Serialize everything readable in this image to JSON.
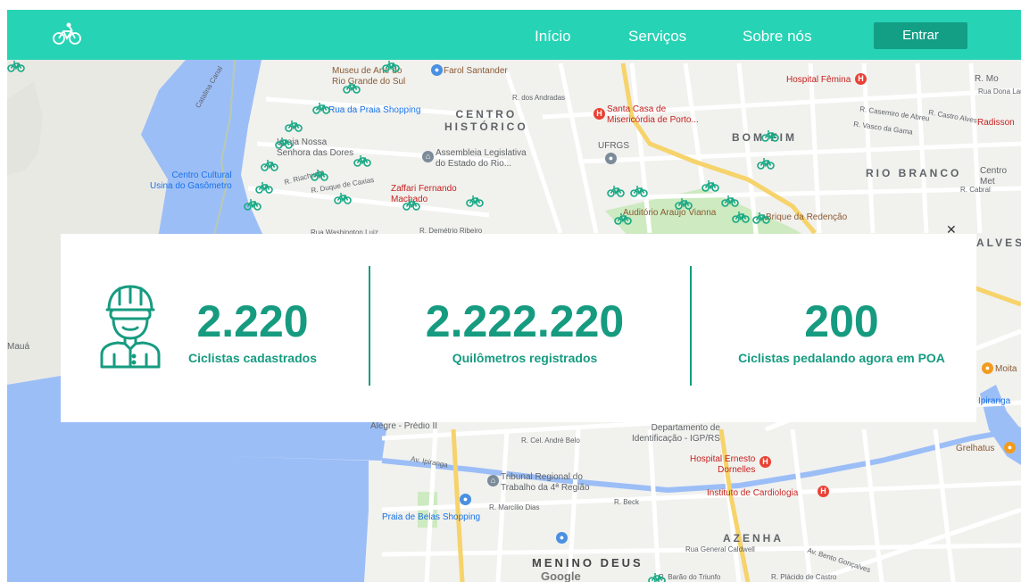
{
  "nav": {
    "links": [
      "Início",
      "Serviços",
      "Sobre nós"
    ],
    "login_label": "Entrar"
  },
  "stats": [
    {
      "value": "2.220",
      "label": "Ciclistas cadastrados"
    },
    {
      "value": "2.222.220",
      "label": "Quilômetros registrados"
    },
    {
      "value": "200",
      "label": "Ciclistas pedalando agora em POA"
    }
  ],
  "map": {
    "labels": {
      "museu": "Museu de Arte do\nRio Grande do Sul",
      "farol": "Farol Santander",
      "praia_shopping": "Rua da Praia Shopping",
      "centro_historico": "CENTRO\nHISTÓRICO",
      "santa_casa": "Santa Casa de\nMisericórdia de Porto...",
      "hospital_femina": "Hospital Fêmina",
      "bom_fim": "BOM FIM",
      "rio_branco": "RIO BRANCO",
      "igreja": "Igreja Nossa\nSenhora das Dores",
      "assembleia": "Assembleia Legislativa\ndo Estado do Rio...",
      "ufrgs": "UFRGS",
      "centro_cultural": "Centro Cultural\nUsina do Gasômetro",
      "zaffari": "Zaffari Fernando\nMachado",
      "auditorio": "Auditório Araújo Vianna",
      "brique": "Brique da Redenção",
      "radisson": "Radisson",
      "maua": "Mauá",
      "alves": "ALVES",
      "alegre": "Alegre - Prédio II",
      "departamento": "Departamento de\nIdentificação - IGP/RS",
      "hospital_ernesto": "Hospital Ernesto\nDornelles",
      "instituto": "Instituto de Cardiologia",
      "tribunal": "Tribunal Regional do\nTrabalho da 4ª Região",
      "praia_belas": "Praia de Belas Shopping",
      "azenha": "AZENHA",
      "menino_deus": "MENINO DEUS",
      "grelhatus": "Grelhatus",
      "moita": "Moita",
      "ipiranga_right": "Ipiranga",
      "google": "Google",
      "centro_met": "Centro\nMet",
      "r_mo": "R. Mo",
      "av_ipiranga": "Av. Ipiranga",
      "av_bento": "Av. Bento Gonçalves",
      "r_barao": "R. Barão do Triunfo",
      "r_placido": "R. Plácido de Castro",
      "r_marcilio": "R. Marcílio Dias",
      "r_beck": "R. Beck",
      "rua_general": "Rua General Caldwell",
      "r_cel_andre": "R. Cel. André Belo",
      "r_demetrio": "R. Demétrio Ribeiro",
      "rua_washington": "Rua Washington Luiz",
      "r_duque": "R. Duque de Caxias",
      "r_riachuelo": "R. Riachuelo",
      "r_andradas": "R. dos Andradas",
      "r_cabral": "R. Cabral",
      "r_vasco": "R. Vasco da Gama",
      "r_casemiro": "R. Casemiro de Abreu",
      "rua_dona_laura": "Rua Dona Laura",
      "r_castro_alves": "R. Castro Alves",
      "catalina": "Catalina Canal"
    }
  },
  "colors": {
    "brand": "#27d3b5",
    "brand_dark": "#139e86",
    "stat_text": "#169b80",
    "water": "#8ab4f8",
    "map_bg": "#f4f3ef"
  },
  "icons": {
    "logo": "bicycle-icon",
    "stats": "cyclist-helmet-icon",
    "map_markers": "bicycle-marker-icon",
    "close": "close-icon"
  }
}
